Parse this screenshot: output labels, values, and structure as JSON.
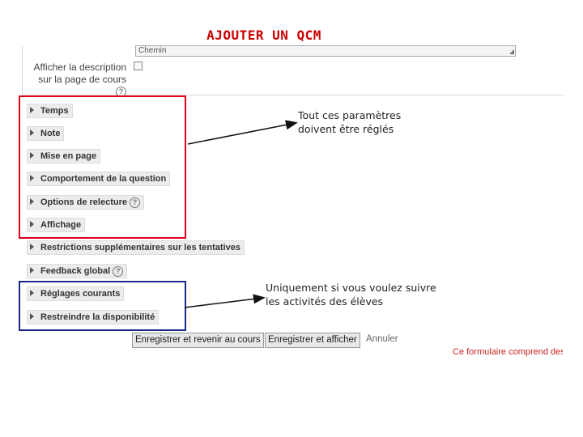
{
  "title": "AJOUTER UN QCM",
  "form": {
    "description_value": "Chemin",
    "show_description_label_1": "Afficher la description",
    "show_description_label_2": "sur la page de cours",
    "help_glyph": "?"
  },
  "sections": [
    {
      "label": "Temps",
      "help": false
    },
    {
      "label": "Note",
      "help": false
    },
    {
      "label": "Mise en page",
      "help": false
    },
    {
      "label": "Comportement de la question",
      "help": false
    },
    {
      "label": "Options de relecture",
      "help": true
    },
    {
      "label": "Affichage",
      "help": false
    },
    {
      "label": "Restrictions supplémentaires sur les tentatives",
      "help": false
    },
    {
      "label": "Feedback global",
      "help": true
    },
    {
      "label": "Réglages courants",
      "help": false
    },
    {
      "label": "Restreindre la disponibilité",
      "help": false
    }
  ],
  "annotations": {
    "red_note_1": "Tout ces paramètres",
    "red_note_2": "doivent être réglés",
    "blue_note_1": "Uniquement si vous voulez suivre",
    "blue_note_2": "les activités des élèves"
  },
  "buttons": {
    "save_return": "Enregistrer et revenir au cours",
    "save_display": "Enregistrer et afficher",
    "cancel": "Annuler"
  },
  "required_note": "Ce formulaire comprend des champs requis, marqués",
  "colors": {
    "title": "#cc0000",
    "red_box": "#e0001a",
    "blue_box": "#1a2a8c",
    "required": "#cc2222"
  }
}
